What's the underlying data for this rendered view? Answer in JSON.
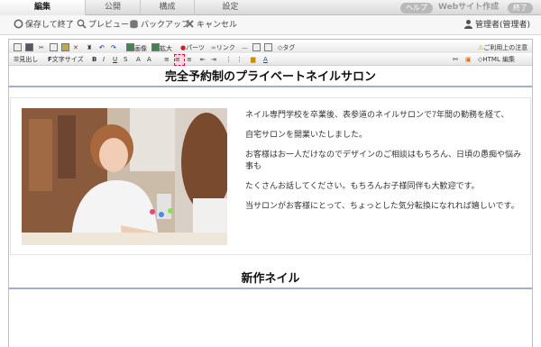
{
  "tabs": [
    {
      "label": "編集",
      "active": true
    },
    {
      "label": "公開",
      "active": false
    },
    {
      "label": "構成",
      "active": false
    },
    {
      "label": "設定",
      "active": false
    }
  ],
  "header_right": {
    "help": "ヘルプ",
    "site_builder": "Webサイト作成",
    "exit": "終了"
  },
  "actions": {
    "save_exit": "保存して終了",
    "preview": "プレビュー",
    "backup": "バックアップ",
    "cancel": "キャンセル",
    "user": "管理者(管理者)"
  },
  "toolbar1": {
    "image": "画像",
    "zoom": "拡大",
    "parts": "パーツ",
    "link": "リンク",
    "tag": "タグ",
    "notice": "ご利用上の注意"
  },
  "toolbar2": {
    "heading": "見出し",
    "font_size": "文字サイズ",
    "html_edit": "HTML 編集"
  },
  "content": {
    "heading1": "完全予約制のプライベートネイルサロン",
    "paragraphs": [
      "ネイル専門学校を卒業後、表参道のネイルサロンで7年間の勤務を経て、",
      "自宅サロンを開業いたしました。",
      "お客様はお一人だけなのでデザインのご相談はもちろん、日頃の愚痴や悩み事も",
      "たくさんお話してください。もちろんお子様同伴も大歓迎です。",
      "当サロンがお客様にとって、ちょっとした気分転換になれれば嬉しいです。"
    ],
    "heading2": "新作ネイル"
  },
  "colors": {
    "accent_rule": "#9fb0c8",
    "selected_tool": "#e0103c"
  }
}
